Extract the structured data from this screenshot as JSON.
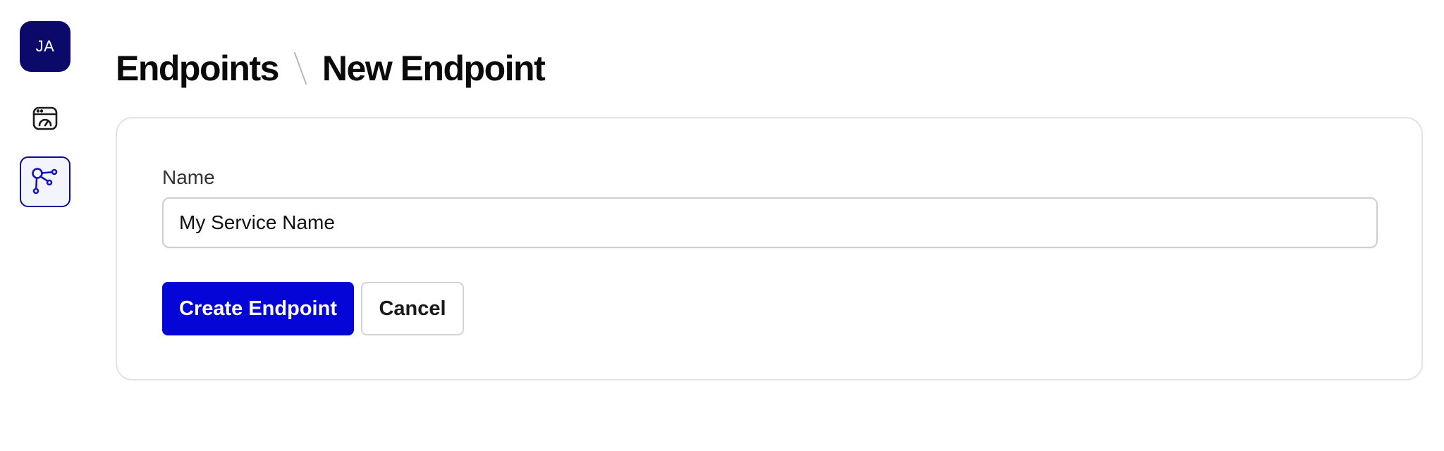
{
  "sidebar": {
    "avatar_initials": "JA",
    "items": [
      {
        "icon": "dashboard-icon",
        "active": false
      },
      {
        "icon": "endpoints-icon",
        "active": true
      }
    ]
  },
  "breadcrumb": {
    "parent": "Endpoints",
    "current": "New Endpoint"
  },
  "form": {
    "name_label": "Name",
    "name_value": "My Service Name",
    "submit_label": "Create Endpoint",
    "cancel_label": "Cancel"
  },
  "colors": {
    "avatar_bg": "#0b0a6b",
    "primary": "#0505d8",
    "active_border": "#0d0d8a"
  }
}
